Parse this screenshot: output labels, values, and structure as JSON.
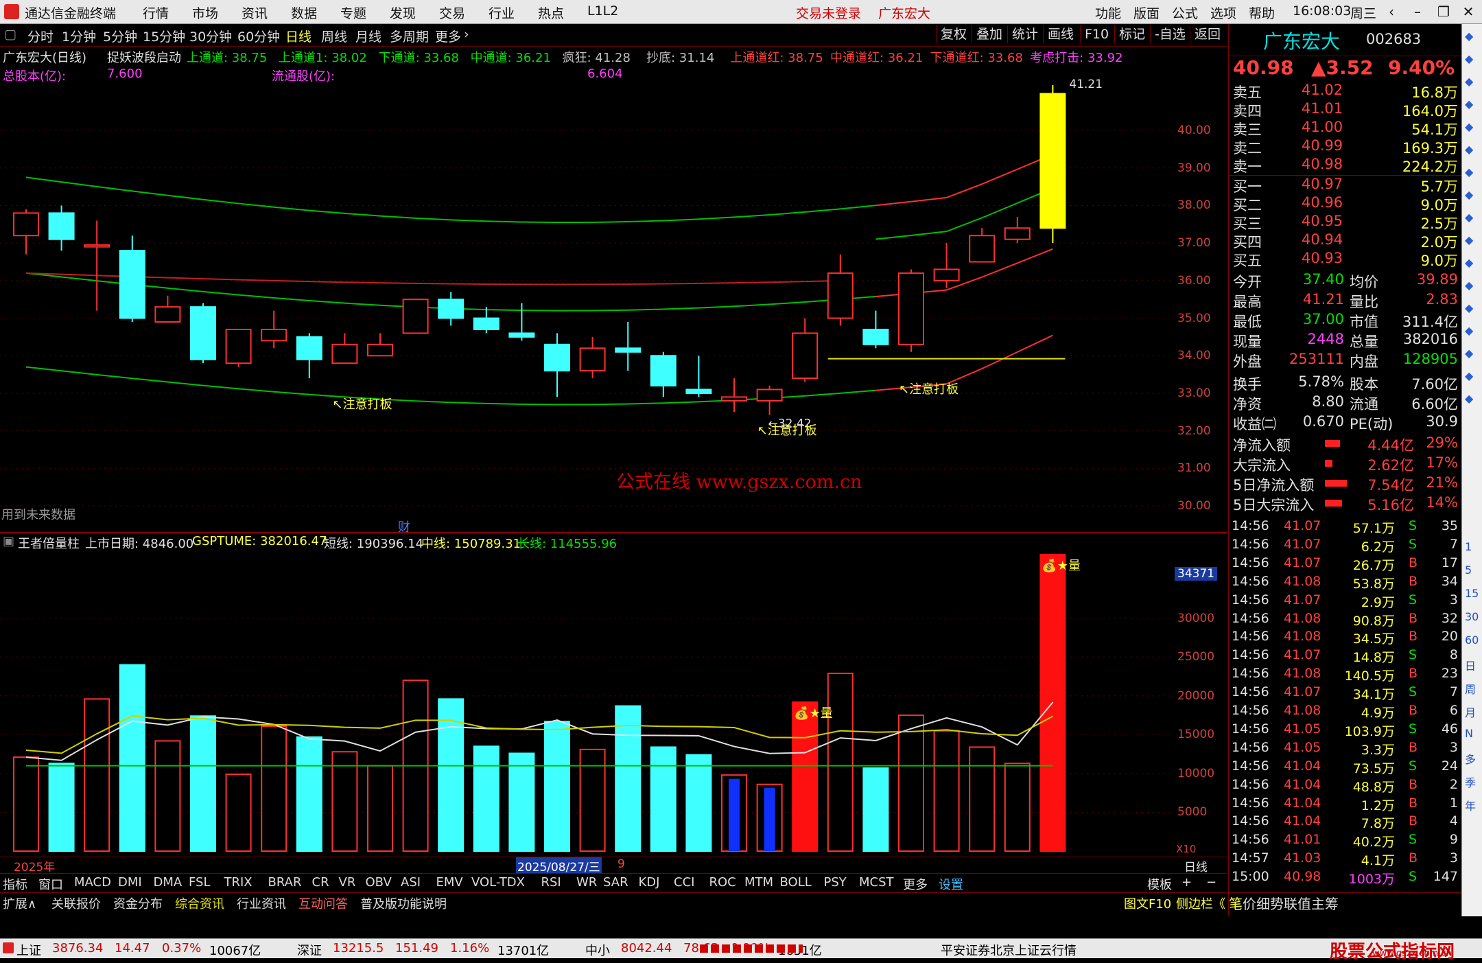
{
  "titlebar": {
    "app_name": "通达信金融终端",
    "menus": [
      "行情",
      "市场",
      "资讯",
      "数据",
      "专题",
      "发现",
      "交易",
      "行业",
      "热点",
      "L1L2"
    ],
    "login_status": "交易未登录",
    "stock_name": "广东宏大",
    "right_menus": [
      "功能",
      "版面",
      "公式",
      "选项",
      "帮助"
    ],
    "time": "16:08:03",
    "weekday": "周三"
  },
  "toolbar": {
    "periods": [
      "分时",
      "1分钟",
      "5分钟",
      "15分钟",
      "30分钟",
      "60分钟",
      "日线",
      "周线",
      "月线",
      "多周期",
      "更多"
    ],
    "active_period": "日线",
    "right_buttons": [
      "复权",
      "叠加",
      "统计",
      "画线",
      "F10",
      "标记",
      "-自选",
      "返回"
    ]
  },
  "kline_info": {
    "name": "广东宏大(日线)",
    "indicator": "捉妖波段启动",
    "params": [
      {
        "label": "上通道: 38.75",
        "color": "#00e000"
      },
      {
        "label": "上通道1: 38.02",
        "color": "#00e000"
      },
      {
        "label": "下通道: 33.68",
        "color": "#00e000"
      },
      {
        "label": "中通道: 36.21",
        "color": "#00e000"
      },
      {
        "label": "疯狂: 41.28",
        "color": "#c0c0c0"
      },
      {
        "label": "抄底: 31.14",
        "color": "#c0c0c0"
      },
      {
        "label": "上通道红: 38.75",
        "color": "#ff4040"
      },
      {
        "label": "中通道红: 36.21",
        "color": "#ff4040"
      },
      {
        "label": "下通道红: 33.68",
        "color": "#ff4040"
      },
      {
        "label": "考虑打击: 33.92",
        "color": "#ff40ff"
      }
    ],
    "total_shares_label": "总股本(亿):",
    "total_shares": "7.600",
    "float_shares_label": "流通股(亿):",
    "float_shares": "6.604",
    "future_data_note": "用到未来数据",
    "cai_tag": "财",
    "watermark": "公式在线  www.gszx.com.cn",
    "annotations": [
      "↖注意打板",
      "↖注意打板",
      "↖注意打板"
    ],
    "high_label": "41.21",
    "low_label": "←32.42",
    "y_axis": [
      "40.00",
      "39.00",
      "38.00",
      "37.00",
      "36.00",
      "35.00",
      "34.00",
      "33.00",
      "32.00",
      "31.00",
      "30.00"
    ]
  },
  "volume_info": {
    "indicator": "王者倍量柱",
    "listing_label": "上市日期: 4846.00",
    "gsptume": "GSPTUME: 382016.47",
    "short": "短线: 190396.14",
    "mid": "中线: 150789.31",
    "long": "长线: 114555.96",
    "badge_text": "量",
    "cursor_value": "34371",
    "y_axis": [
      "30000",
      "25000",
      "20000",
      "15000",
      "10000",
      "5000"
    ],
    "multiplier": "X10"
  },
  "xaxis": {
    "year": "2025年",
    "cursor_date": "2025/08/27/三",
    "month": "9",
    "period": "日线"
  },
  "indicator_tabs": [
    "指标",
    "窗口",
    "MACD",
    "DMI",
    "DMA",
    "FSL",
    "TRIX",
    "BRAR",
    "CR",
    "VR",
    "OBV",
    "ASI",
    "EMV",
    "VOL-TDX",
    "RSI",
    "WR",
    "SAR",
    "KDJ",
    "CCI",
    "ROC",
    "MTM",
    "BOLL",
    "PSY",
    "MCST",
    "更多",
    "设置"
  ],
  "template_btn": "模板",
  "bottom_tabs": [
    "扩展∧",
    "关联报价",
    "资金分布",
    "综合资讯",
    "行业资讯",
    "互动问答",
    "普及版功能说明"
  ],
  "bottom_right": [
    "图文F10",
    "侧边栏《"
  ],
  "panel_tabs": [
    "笔",
    "价",
    "细",
    "势",
    "联",
    "值",
    "主",
    "筹"
  ],
  "chart_data": {
    "type": "candlestick",
    "ylim": [
      29.8,
      41.5
    ],
    "candles": [
      {
        "o": 37.2,
        "c": 37.8,
        "h": 37.9,
        "l": 36.7
      },
      {
        "o": 37.8,
        "c": 37.1,
        "h": 38.0,
        "l": 36.8
      },
      {
        "o": 36.9,
        "c": 36.95,
        "h": 37.6,
        "l": 35.2
      },
      {
        "o": 36.8,
        "c": 35.0,
        "h": 37.2,
        "l": 34.9
      },
      {
        "o": 34.9,
        "c": 35.3,
        "h": 35.6,
        "l": 34.9
      },
      {
        "o": 35.3,
        "c": 33.9,
        "h": 35.4,
        "l": 33.8
      },
      {
        "o": 33.8,
        "c": 34.7,
        "h": 34.7,
        "l": 33.7
      },
      {
        "o": 34.4,
        "c": 34.7,
        "h": 35.2,
        "l": 34.2
      },
      {
        "o": 34.5,
        "c": 33.9,
        "h": 34.6,
        "l": 33.4
      },
      {
        "o": 33.8,
        "c": 34.3,
        "h": 34.6,
        "l": 33.8
      },
      {
        "o": 34.0,
        "c": 34.3,
        "h": 34.6,
        "l": 34.0
      },
      {
        "o": 34.6,
        "c": 35.5,
        "h": 35.5,
        "l": 34.6
      },
      {
        "o": 35.5,
        "c": 35.0,
        "h": 35.7,
        "l": 34.8
      },
      {
        "o": 35.0,
        "c": 34.7,
        "h": 35.3,
        "l": 34.6
      },
      {
        "o": 34.6,
        "c": 34.5,
        "h": 35.4,
        "l": 34.4
      },
      {
        "o": 34.3,
        "c": 33.6,
        "h": 34.6,
        "l": 32.9
      },
      {
        "o": 33.6,
        "c": 34.2,
        "h": 34.5,
        "l": 33.4
      },
      {
        "o": 34.2,
        "c": 34.1,
        "h": 34.9,
        "l": 33.6
      },
      {
        "o": 34.0,
        "c": 33.2,
        "h": 34.1,
        "l": 32.9
      },
      {
        "o": 33.1,
        "c": 33.0,
        "h": 34.0,
        "l": 32.9
      },
      {
        "o": 32.8,
        "c": 32.9,
        "h": 33.4,
        "l": 32.5
      },
      {
        "o": 32.8,
        "c": 33.1,
        "h": 33.2,
        "l": 32.42
      },
      {
        "o": 33.4,
        "c": 34.6,
        "h": 35.0,
        "l": 33.3
      },
      {
        "o": 35.0,
        "c": 36.2,
        "h": 36.7,
        "l": 34.8
      },
      {
        "o": 34.7,
        "c": 34.3,
        "h": 35.2,
        "l": 34.2
      },
      {
        "o": 34.3,
        "c": 36.2,
        "h": 36.3,
        "l": 34.1
      },
      {
        "o": 36.0,
        "c": 36.3,
        "h": 37.0,
        "l": 35.8
      },
      {
        "o": 36.5,
        "c": 37.2,
        "h": 37.4,
        "l": 36.5
      },
      {
        "o": 37.1,
        "c": 37.4,
        "h": 37.7,
        "l": 37.0
      },
      {
        "o": 37.4,
        "c": 40.98,
        "h": 41.21,
        "l": 37.0
      }
    ],
    "volume": [
      12100,
      11300,
      19600,
      24000,
      14200,
      17400,
      9900,
      16100,
      14700,
      12800,
      11000,
      22000,
      19600,
      13500,
      12600,
      16700,
      13100,
      18700,
      13400,
      12400,
      9800,
      8600,
      19200,
      22900,
      10700,
      17500,
      15500,
      13400,
      11300,
      38200
    ],
    "volume_ylim": [
      0,
      38200
    ]
  },
  "quote": {
    "name": "广东宏大",
    "code": "002683",
    "price": "40.98",
    "change": "▲3.52",
    "pct": "9.40%",
    "asks": [
      {
        "label": "卖五",
        "price": "41.02",
        "vol": "16.8万"
      },
      {
        "label": "卖四",
        "price": "41.01",
        "vol": "164.0万"
      },
      {
        "label": "卖三",
        "price": "41.00",
        "vol": "54.1万"
      },
      {
        "label": "卖二",
        "price": "40.99",
        "vol": "169.3万"
      },
      {
        "label": "卖一",
        "price": "40.98",
        "vol": "224.2万"
      }
    ],
    "bids": [
      {
        "label": "买一",
        "price": "40.97",
        "vol": "5.7万"
      },
      {
        "label": "买二",
        "price": "40.96",
        "vol": "9.0万"
      },
      {
        "label": "买三",
        "price": "40.95",
        "vol": "2.5万"
      },
      {
        "label": "买四",
        "price": "40.94",
        "vol": "2.0万"
      },
      {
        "label": "买五",
        "price": "40.93",
        "vol": "9.0万"
      }
    ],
    "stats": [
      {
        "l1": "今开",
        "v1": "37.40",
        "c1": "#00e000",
        "l2": "均价",
        "v2": "39.89",
        "c2": "#ff4040"
      },
      {
        "l1": "最高",
        "v1": "41.21",
        "c1": "#ff4040",
        "l2": "量比",
        "v2": "2.83",
        "c2": "#ff4040"
      },
      {
        "l1": "最低",
        "v1": "37.00",
        "c1": "#00e000",
        "l2": "市值",
        "v2": "311.4亿",
        "c2": "#e0e0e0"
      },
      {
        "l1": "现量",
        "v1": "2448",
        "c1": "#ff40ff",
        "l2": "总量",
        "v2": "382016",
        "c2": "#e0e0e0"
      },
      {
        "l1": "外盘",
        "v1": "253111",
        "c1": "#ff4040",
        "l2": "内盘",
        "v2": "128905",
        "c2": "#00e000"
      },
      {
        "l1": "换手",
        "v1": "5.78%",
        "c1": "#e0e0e0",
        "l2": "股本",
        "v2": "7.60亿",
        "c2": "#e0e0e0"
      },
      {
        "l1": "净资",
        "v1": "8.80",
        "c1": "#e0e0e0",
        "l2": "流通",
        "v2": "6.60亿",
        "c2": "#e0e0e0"
      },
      {
        "l1": "收益㈡",
        "v1": "0.670",
        "c1": "#e0e0e0",
        "l2": "PE(动)",
        "v2": "30.9",
        "c2": "#e0e0e0"
      }
    ],
    "flows": [
      {
        "label": "净流入额",
        "val": "4.44亿",
        "pct": "29%",
        "bar": 0.6
      },
      {
        "label": "大宗流入",
        "val": "2.62亿",
        "pct": "17%",
        "bar": 0.3
      },
      {
        "label": "5日净流入额",
        "val": "7.54亿",
        "pct": "21%",
        "bar": 0.9
      },
      {
        "label": "5日大宗流入",
        "val": "5.16亿",
        "pct": "14%",
        "bar": 0.7
      }
    ],
    "ticks": [
      {
        "t": "14:56",
        "p": "41.07",
        "v": "57.1万",
        "s": "S",
        "n": "35"
      },
      {
        "t": "14:56",
        "p": "41.07",
        "v": "6.2万",
        "s": "S",
        "n": "7"
      },
      {
        "t": "14:56",
        "p": "41.07",
        "v": "26.7万",
        "s": "B",
        "n": "17"
      },
      {
        "t": "14:56",
        "p": "41.08",
        "v": "53.8万",
        "s": "B",
        "n": "34"
      },
      {
        "t": "14:56",
        "p": "41.07",
        "v": "2.9万",
        "s": "S",
        "n": "3"
      },
      {
        "t": "14:56",
        "p": "41.08",
        "v": "90.8万",
        "s": "B",
        "n": "32"
      },
      {
        "t": "14:56",
        "p": "41.08",
        "v": "34.5万",
        "s": "B",
        "n": "20"
      },
      {
        "t": "14:56",
        "p": "41.07",
        "v": "14.8万",
        "s": "S",
        "n": "8"
      },
      {
        "t": "14:56",
        "p": "41.08",
        "v": "140.5万",
        "s": "B",
        "n": "23"
      },
      {
        "t": "14:56",
        "p": "41.07",
        "v": "34.1万",
        "s": "S",
        "n": "7"
      },
      {
        "t": "14:56",
        "p": "41.08",
        "v": "4.9万",
        "s": "B",
        "n": "6"
      },
      {
        "t": "14:56",
        "p": "41.05",
        "v": "103.9万",
        "s": "S",
        "n": "46"
      },
      {
        "t": "14:56",
        "p": "41.05",
        "v": "3.3万",
        "s": "B",
        "n": "3"
      },
      {
        "t": "14:56",
        "p": "41.04",
        "v": "73.5万",
        "s": "S",
        "n": "24"
      },
      {
        "t": "14:56",
        "p": "41.04",
        "v": "48.8万",
        "s": "B",
        "n": "2"
      },
      {
        "t": "14:56",
        "p": "41.04",
        "v": "1.2万",
        "s": "B",
        "n": "1"
      },
      {
        "t": "14:56",
        "p": "41.04",
        "v": "7.8万",
        "s": "B",
        "n": "4"
      },
      {
        "t": "14:56",
        "p": "41.01",
        "v": "40.2万",
        "s": "S",
        "n": "9"
      },
      {
        "t": "14:57",
        "p": "41.03",
        "v": "4.1万",
        "s": "B",
        "n": "3"
      },
      {
        "t": "15:00",
        "p": "40.98",
        "v": "1003万",
        "s": "S",
        "n": "147"
      }
    ]
  },
  "statusbar": {
    "items": [
      {
        "text": "上证",
        "color": "#000"
      },
      {
        "text": "3876.34",
        "color": "#d00000"
      },
      {
        "text": "14.47",
        "color": "#d00000"
      },
      {
        "text": "0.37%",
        "color": "#d00000"
      },
      {
        "text": "10067亿",
        "color": "#000"
      },
      {
        "text": "深证",
        "color": "#000"
      },
      {
        "text": "13215.5",
        "color": "#d00000"
      },
      {
        "text": "151.49",
        "color": "#d00000"
      },
      {
        "text": "1.16%",
        "color": "#d00000"
      },
      {
        "text": "13701亿",
        "color": "#000"
      },
      {
        "text": "中小",
        "color": "#000"
      },
      {
        "text": "8042.44",
        "color": "#d00000"
      },
      {
        "text": "78.63",
        "color": "#d00000"
      },
      {
        "text": "0.99%",
        "color": "#d00000"
      },
      {
        "text": "1651亿",
        "color": "#000"
      },
      {
        "text": "平安证券北京上证云行情",
        "color": "#000"
      }
    ],
    "site_logo": "股票公式指标网",
    "site_url": "www.gszx.com.cn"
  },
  "sidebar_labels": [
    "1",
    "5",
    "15",
    "30",
    "60",
    "日",
    "周",
    "月",
    "N",
    "多",
    "季",
    "年"
  ]
}
